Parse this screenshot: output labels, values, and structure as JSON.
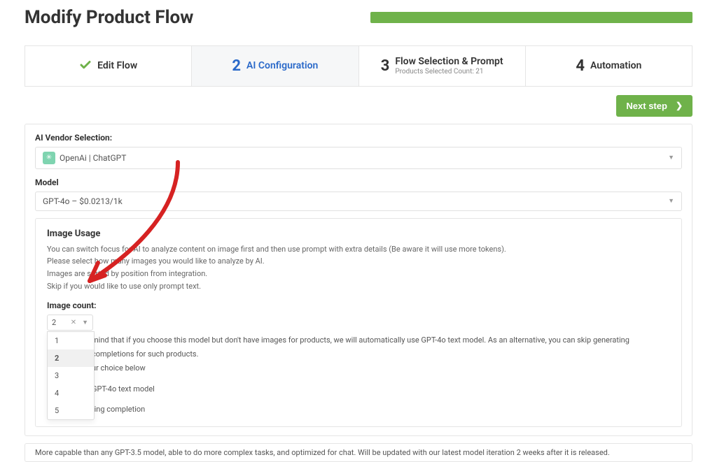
{
  "pageTitle": "Modify Product Flow",
  "steps": {
    "s1": {
      "label": "Edit Flow"
    },
    "s2": {
      "num": "2",
      "label": "AI Configuration"
    },
    "s3": {
      "num": "3",
      "label": "Flow Selection & Prompt",
      "sub": "Products Selected Count: 21"
    },
    "s4": {
      "num": "4",
      "label": "Automation"
    }
  },
  "nextBtn": "Next step",
  "vendor": {
    "label": "AI Vendor Selection:",
    "value": "OpenAi | ChatGPT"
  },
  "model": {
    "label": "Model",
    "value": "GPT-4o  – $0.0213/1k"
  },
  "imageUsage": {
    "title": "Image Usage",
    "line1": "You can switch focus for AI to analyze content on image first and then use prompt with extra details (Be aware it will use more tokens).",
    "line2": "Please select how many images you would like to analyze by AI.",
    "line3": "Images are sorted by position from integration.",
    "line4": "Skip if you would like to use only prompt text.",
    "countLabel": "Image count:",
    "selected": "2",
    "options": {
      "o1": "1",
      "o2": "2",
      "o3": "3",
      "o4": "4",
      "o5": "5"
    },
    "hint1": "mind that if you choose this model but don't have images for products, we will automatically use GPT-4o text model. As an alternative, you can skip generating completions for such products.",
    "hint1b": "ur choice below",
    "hint2": "GPT-4o text model",
    "hint3": "ting completion"
  },
  "footer": "More capable than any GPT-3.5 model, able to do more complex tasks, and optimized for chat. Will be updated with our latest model iteration 2 weeks after it is released."
}
